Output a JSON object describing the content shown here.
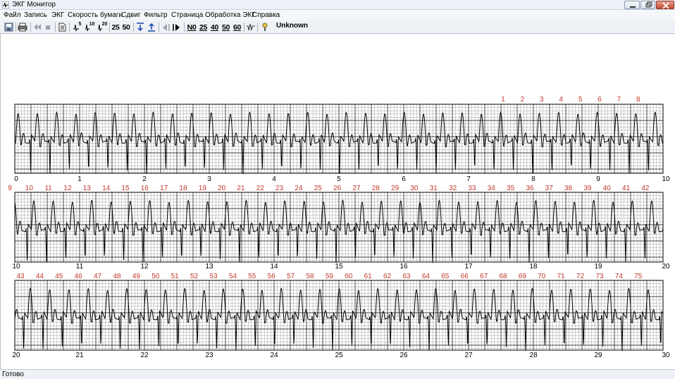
{
  "window": {
    "title": "ЭКГ Монитор",
    "icon": "ecg-app-icon"
  },
  "menu": {
    "items": [
      "Файл",
      "Запись",
      "ЭКГ",
      "Скорость бумаги",
      "Сдвиг",
      "Фильтр",
      "Страница",
      "Обработка ЭКГ",
      "Справка"
    ]
  },
  "toolbar": {
    "speed_25": "25",
    "speed_50": "50",
    "no_filter": "N0",
    "filter_25": "25",
    "filter_40": "40",
    "filter_50": "50",
    "filter_60": "60",
    "gain_5": "5",
    "gain_10": "10",
    "gain_20": "20",
    "status_label": "Unknown"
  },
  "ecg": {
    "strips": [
      {
        "time_labels": [
          "0",
          "1",
          "2",
          "3",
          "4",
          "5",
          "6",
          "7",
          "8",
          "9",
          "10"
        ],
        "beat_numbers": [
          "1",
          "2",
          "3",
          "4",
          "5",
          "6",
          "7",
          "8"
        ]
      },
      {
        "time_labels": [
          "10",
          "11",
          "12",
          "13",
          "14",
          "15",
          "16",
          "17",
          "18",
          "19",
          "20"
        ],
        "beat_numbers": [
          "9",
          "10",
          "11",
          "12",
          "13",
          "14",
          "15",
          "16",
          "17",
          "18",
          "19",
          "20",
          "21",
          "22",
          "23",
          "24",
          "25",
          "26",
          "27",
          "28",
          "29",
          "30",
          "31",
          "32",
          "33",
          "34",
          "35",
          "36",
          "37",
          "38",
          "39",
          "40",
          "41",
          "42"
        ]
      },
      {
        "time_labels": [
          "20",
          "21",
          "22",
          "23",
          "24",
          "25",
          "26",
          "27",
          "28",
          "29",
          "30"
        ],
        "beat_numbers": [
          "43",
          "44",
          "45",
          "46",
          "47",
          "48",
          "49",
          "50",
          "51",
          "52",
          "53",
          "54",
          "55",
          "56",
          "57",
          "58",
          "59",
          "60",
          "61",
          "62",
          "63",
          "64",
          "65",
          "66",
          "67",
          "68",
          "69",
          "70",
          "71",
          "72",
          "73",
          "74",
          "75"
        ]
      }
    ],
    "colors": {
      "grid_major": "#000000",
      "grid_minor": "#7a7a7a",
      "trace": "#000000",
      "beat_number": "#c0392b"
    }
  },
  "status": {
    "text": "Готово"
  }
}
